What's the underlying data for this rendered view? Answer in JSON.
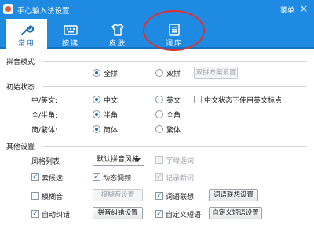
{
  "window": {
    "title": "手心输入法设置",
    "menu_label": "菜单",
    "close_glyph": "×"
  },
  "tabs": [
    {
      "label": "常用",
      "icon": "wrench-icon",
      "active": true
    },
    {
      "label": "按键",
      "icon": "keyboard-icon",
      "active": false
    },
    {
      "label": "皮肤",
      "icon": "tshirt-icon",
      "active": false
    },
    {
      "label": "词库",
      "icon": "dictionary-icon",
      "active": false
    }
  ],
  "pinyin_mode": {
    "title": "拼音模式",
    "option_full": "全拼",
    "option_double": "双拼",
    "selected": "全拼",
    "double_scheme_button": "双拼方案设置"
  },
  "initial_state": {
    "title": "初始状态",
    "rows": [
      {
        "label": "中/英文:",
        "opt1": "中文",
        "opt2": "英文",
        "selected": "中文",
        "extra_checkbox": "中文状态下使用英文标点",
        "extra_checked": false
      },
      {
        "label": "全/半角:",
        "opt1": "半角",
        "opt2": "全角",
        "selected": "半角"
      },
      {
        "label": "简/繁体:",
        "opt1": "简体",
        "opt2": "繁体",
        "selected": "简体"
      }
    ]
  },
  "other_settings": {
    "title": "其他设置",
    "style_list_label": "风格列表",
    "style_selected": "默认拼音风格",
    "input_code_select": "字母选词",
    "cloud_candidates": "云候选",
    "dynamic_frequency": "动态调频",
    "remember_new_words": "记录新词",
    "fuzzy_pinyin": "模糊音",
    "fuzzy_settings_button": "模糊音设置",
    "word_association": "词语联想",
    "association_settings_button": "词语联想设置",
    "auto_correct": "自动纠错",
    "correct_settings_button": "拼音纠错设置",
    "custom_phrases": "自定义短语",
    "custom_phrases_button": "自定义短语设置"
  },
  "colors": {
    "title_bar": "#1e8ae2",
    "accent": "#1a6ec4",
    "annotation_circle": "#e03030"
  }
}
